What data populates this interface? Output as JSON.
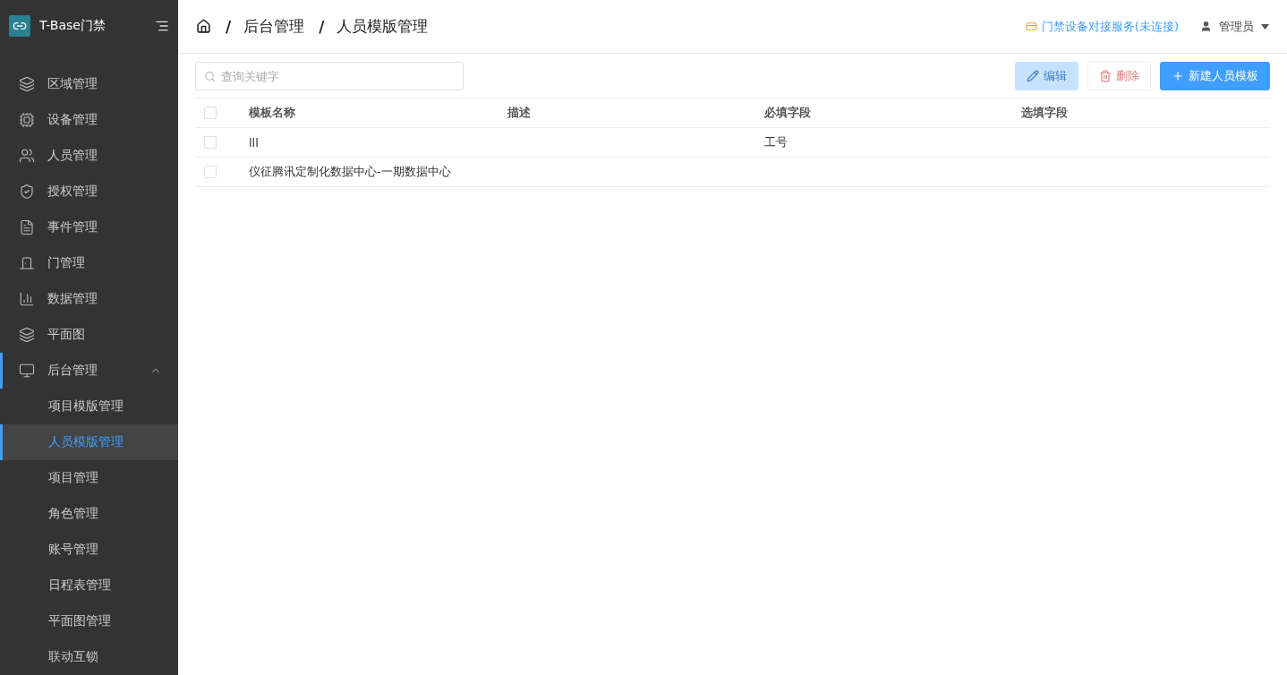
{
  "app": {
    "title": "T-Base门禁"
  },
  "sidebar": {
    "items": [
      {
        "kind": "item",
        "label": "区域管理",
        "selected": false
      },
      {
        "kind": "item",
        "label": "设备管理",
        "selected": false
      },
      {
        "kind": "item",
        "label": "人员管理",
        "selected": false
      },
      {
        "kind": "item",
        "label": "授权管理",
        "selected": false
      },
      {
        "kind": "item",
        "label": "事件管理",
        "selected": false
      },
      {
        "kind": "item",
        "label": "门管理",
        "selected": false
      },
      {
        "kind": "item",
        "label": "数据管理",
        "selected": false
      },
      {
        "kind": "item",
        "label": "平面图",
        "selected": false
      },
      {
        "kind": "group",
        "label": "后台管理",
        "selected": true,
        "expanded": true,
        "children": [
          {
            "label": "项目模版管理",
            "selected": false
          },
          {
            "label": "人员模版管理",
            "selected": true
          },
          {
            "label": "项目管理",
            "selected": false
          },
          {
            "label": "角色管理",
            "selected": false
          },
          {
            "label": "账号管理",
            "selected": false
          },
          {
            "label": "日程表管理",
            "selected": false
          },
          {
            "label": "平面图管理",
            "selected": false
          },
          {
            "label": "联动互锁",
            "selected": false
          }
        ]
      }
    ]
  },
  "breadcrumb": [
    "后台管理",
    "人员模版管理"
  ],
  "breadcrumb_separator": "/",
  "service_status": "门禁设备对接服务(未连接)",
  "user": "管理员",
  "search": {
    "placeholder": "查询关键字"
  },
  "buttons": [
    {
      "kind": "edit",
      "label": "编辑",
      "disabled": true
    },
    {
      "kind": "delete",
      "label": "删除",
      "disabled": true
    },
    {
      "kind": "add",
      "label": "新建人员模板",
      "disabled": false
    }
  ],
  "table": {
    "columns": [
      "模板名称",
      "描述",
      "必填字段",
      "选填字段"
    ],
    "header_checked": false,
    "rows": [
      {
        "checked": false,
        "cells": [
          "lll",
          "",
          "工号",
          ""
        ]
      },
      {
        "checked": false,
        "cells": [
          "仪征腾讯定制化数据中心-一期数据中心",
          "",
          "",
          ""
        ]
      }
    ]
  }
}
